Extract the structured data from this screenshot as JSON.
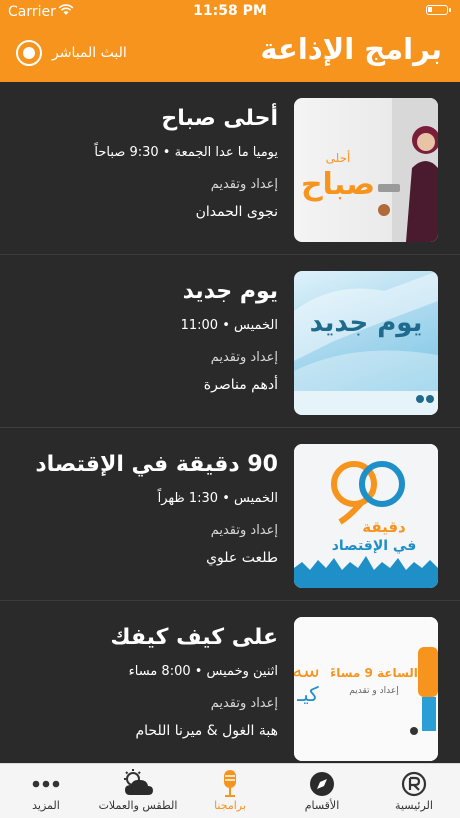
{
  "status_bar": {
    "carrier": "Carrier",
    "time": "11:58 PM"
  },
  "header": {
    "title": "برامج الإذاعة",
    "live_label": "البث المباشر"
  },
  "accent_color": "#f7941d",
  "programs": [
    {
      "title": "أحلى صباح",
      "schedule": "يوميا ما عدا الجمعة • 9:30 صباحاً",
      "prep_label": "إعداد وتقديم",
      "host": "نجوى الحمدان",
      "thumb_text_top": "أحلى",
      "thumb_text": "صباح"
    },
    {
      "title": "يوم جديد",
      "schedule": "الخميس • 11:00",
      "prep_label": "إعداد وتقديم",
      "host": "أدهم مناصرة",
      "thumb_text": "يوم جديد"
    },
    {
      "title": "90 دقيقة في الإقتصاد",
      "schedule": "الخميس • 1:30 ظهراً",
      "prep_label": "إعداد وتقديم",
      "host": "طلعت علوي",
      "thumb_text": "دقيقة",
      "thumb_text2": "في الإقتصاد"
    },
    {
      "title": "على كيف كيفك",
      "schedule": "اثنين وخميس • 8:00 مساء",
      "prep_label": "إعداد وتقديم",
      "host": "هبة الغول & ميرنا اللحام",
      "thumb_text": "الساعة 9 مساءً",
      "thumb_text2": "إعداد و تقديم",
      "thumb_text3": "سه",
      "thumb_text4": "كيـ"
    }
  ],
  "tabs": [
    {
      "label": "الرئيسية",
      "icon": "registered-icon"
    },
    {
      "label": "الأقسام",
      "icon": "compass-icon"
    },
    {
      "label": "برامجنا",
      "icon": "microphone-icon",
      "active": true
    },
    {
      "label": "الطقس والعملات",
      "icon": "weather-icon"
    },
    {
      "label": "المزيد",
      "icon": "more-icon"
    }
  ]
}
